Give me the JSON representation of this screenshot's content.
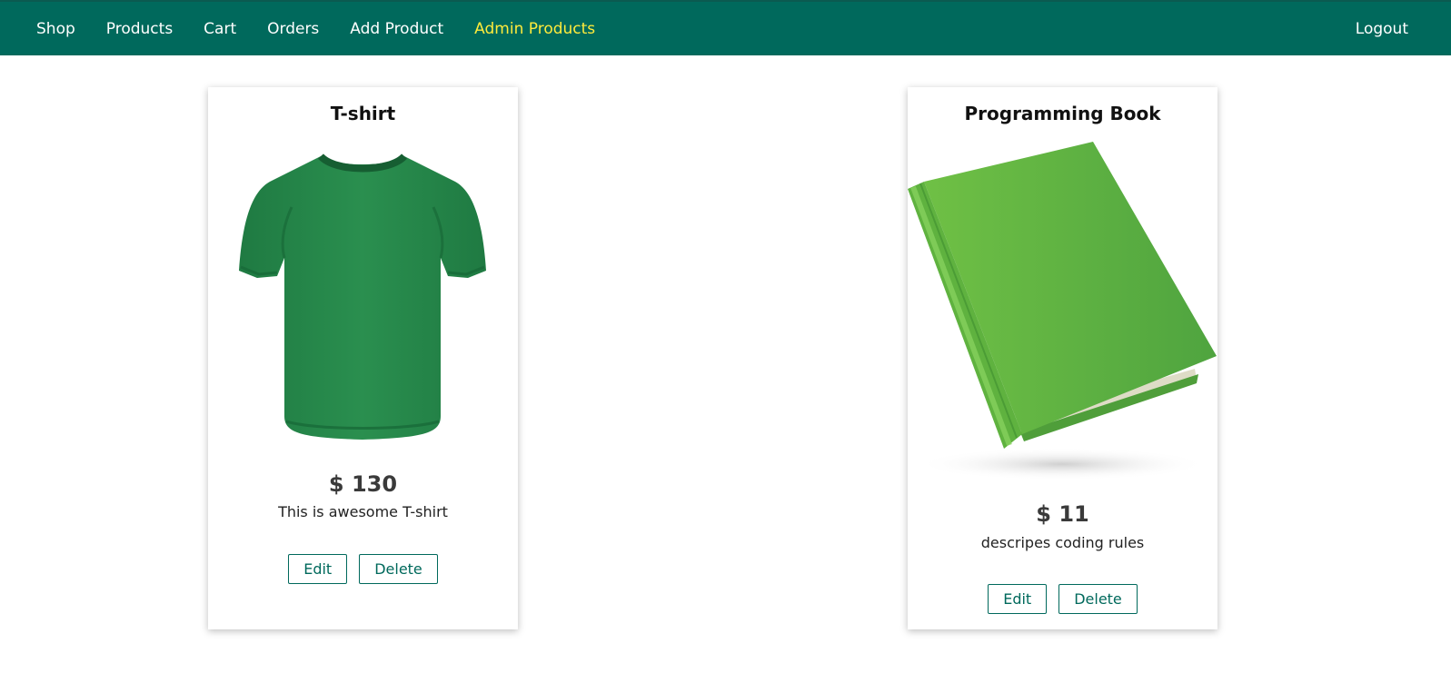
{
  "nav": {
    "items": [
      {
        "label": "Shop"
      },
      {
        "label": "Products"
      },
      {
        "label": "Cart"
      },
      {
        "label": "Orders"
      },
      {
        "label": "Add Product"
      },
      {
        "label": "Admin Products"
      }
    ],
    "active": "Admin Products",
    "logout_label": "Logout"
  },
  "colors": {
    "header": "#00695c",
    "active_nav": "#ffeb3b",
    "button_border": "#00695c"
  },
  "products": [
    {
      "title": "T-shirt",
      "image_icon": "green-tshirt-image",
      "price": "$ 130",
      "description": "This is awesome T-shirt",
      "edit_label": "Edit",
      "delete_label": "Delete"
    },
    {
      "title": "Programming Book",
      "image_icon": "green-book-image",
      "price": "$ 11",
      "description": "descripes coding rules",
      "edit_label": "Edit",
      "delete_label": "Delete"
    }
  ]
}
